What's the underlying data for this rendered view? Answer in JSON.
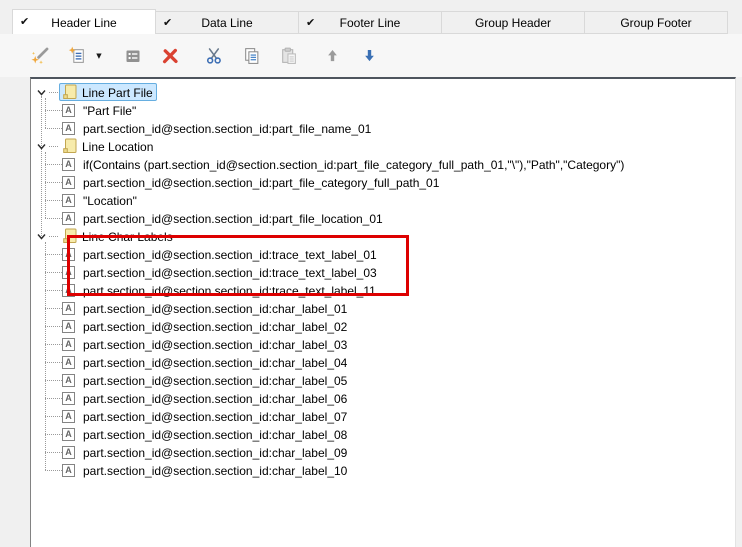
{
  "ui": {
    "check_glyph": "✔",
    "dropdown_glyph": "▼",
    "text_item_glyph": "A"
  },
  "tabs": [
    {
      "label": "Header Line",
      "checked": true,
      "active": true
    },
    {
      "label": "Data Line",
      "checked": true,
      "active": false
    },
    {
      "label": "Footer Line",
      "checked": true,
      "active": false
    },
    {
      "label": "Group Header",
      "checked": false,
      "active": false
    },
    {
      "label": "Group Footer",
      "checked": false,
      "active": false
    }
  ],
  "toolbar": {
    "buttons": [
      {
        "name": "wizard",
        "icon": "magic-wand-icon",
        "enabled": true,
        "has_dropdown": false
      },
      {
        "name": "new-item",
        "icon": "new-document-icon",
        "enabled": true,
        "has_dropdown": true
      },
      {
        "name": "properties",
        "icon": "properties-icon",
        "enabled": true,
        "has_dropdown": false
      },
      {
        "name": "delete",
        "icon": "delete-x-icon",
        "enabled": true,
        "has_dropdown": false
      },
      {
        "name": "cut",
        "icon": "scissors-icon",
        "enabled": true,
        "has_dropdown": false
      },
      {
        "name": "copy",
        "icon": "copy-icon",
        "enabled": true,
        "has_dropdown": false
      },
      {
        "name": "paste",
        "icon": "paste-icon",
        "enabled": false,
        "has_dropdown": false
      },
      {
        "name": "move-up",
        "icon": "arrow-up-icon",
        "enabled": false,
        "has_dropdown": false
      },
      {
        "name": "move-down",
        "icon": "arrow-down-icon",
        "enabled": true,
        "has_dropdown": false
      }
    ]
  },
  "tree": {
    "groups": [
      {
        "label": "Line Part File",
        "selected": true,
        "expanded": true,
        "children": [
          "\"Part File\"",
          "part.section_id@section.section_id:part_file_name_01"
        ]
      },
      {
        "label": "Line Location",
        "selected": false,
        "expanded": true,
        "children": [
          "if(Contains (part.section_id@section.section_id:part_file_category_full_path_01,\"\\\"),\"Path\",\"Category\")",
          "part.section_id@section.section_id:part_file_category_full_path_01",
          "\"Location\"",
          "part.section_id@section.section_id:part_file_location_01"
        ]
      },
      {
        "label": "Line Char Labels",
        "selected": false,
        "expanded": true,
        "children": [
          "part.section_id@section.section_id:trace_text_label_01",
          "part.section_id@section.section_id:trace_text_label_03",
          "part.section_id@section.section_id:trace_text_label_11",
          "part.section_id@section.section_id:char_label_01",
          "part.section_id@section.section_id:char_label_02",
          "part.section_id@section.section_id:char_label_03",
          "part.section_id@section.section_id:char_label_04",
          "part.section_id@section.section_id:char_label_05",
          "part.section_id@section.section_id:char_label_06",
          "part.section_id@section.section_id:char_label_07",
          "part.section_id@section.section_id:char_label_08",
          "part.section_id@section.section_id:char_label_09",
          "part.section_id@section.section_id:char_label_10"
        ]
      }
    ]
  },
  "annotation": {
    "highlight_color": "#dd0000",
    "highlighted_items": [
      "part.section_id@section.section_id:trace_text_label_01",
      "part.section_id@section.section_id:trace_text_label_03",
      "part.section_id@section.section_id:trace_text_label_11"
    ]
  }
}
